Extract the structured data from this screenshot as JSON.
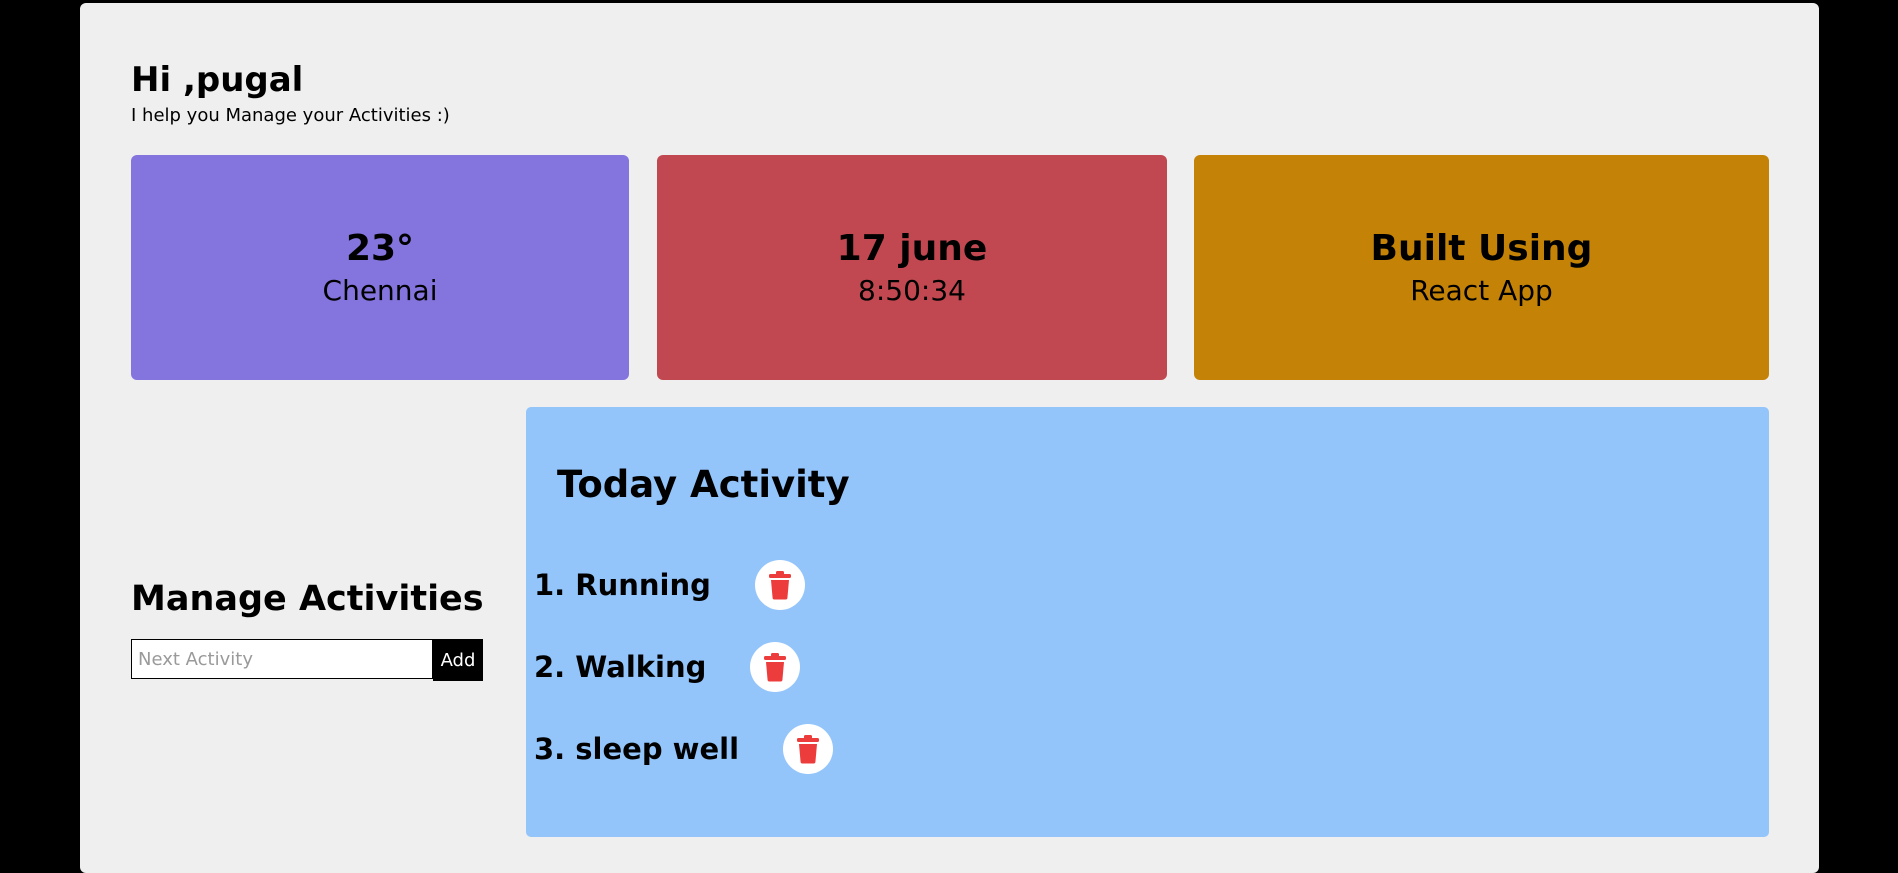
{
  "header": {
    "greeting": "Hi ,pugal",
    "subtitle": "I help you Manage your Activities :)"
  },
  "cards": {
    "weather": {
      "temperature": "23°",
      "city": "Chennai",
      "color": "#8474dd"
    },
    "date": {
      "date": "17 june",
      "time": "8:50:34",
      "color": "#c14851"
    },
    "built": {
      "title": "Built Using",
      "tech": "React App",
      "color": "#c48307"
    }
  },
  "manage": {
    "title": "Manage Activities",
    "input_placeholder": "Next Activity",
    "input_value": "",
    "add_label": "Add"
  },
  "today": {
    "title": "Today Activity",
    "color": "#93c5fb",
    "activities": [
      {
        "label": "1. Running"
      },
      {
        "label": "2. Walking"
      },
      {
        "label": "3. sleep well"
      }
    ],
    "delete_icon": "trash-icon",
    "delete_color": "#ec3c3c"
  }
}
